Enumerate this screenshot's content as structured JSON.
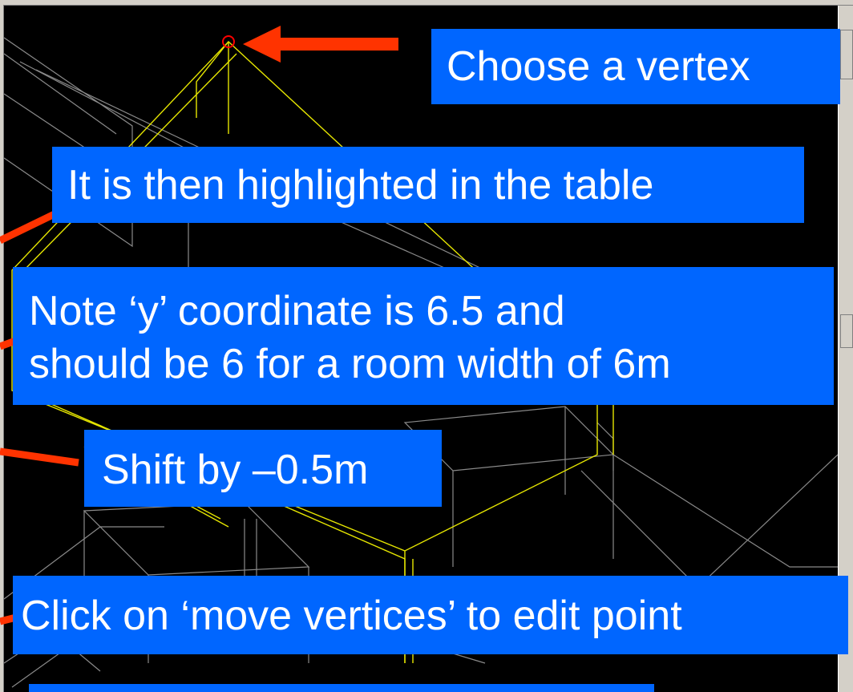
{
  "colors": {
    "callout_bg": "#0066ff",
    "callout_text": "#ffffff",
    "pointer_red": "#ff3300",
    "wire_yellow": "#e6e600",
    "wire_grey": "#8a8a8a",
    "vertex_marker": "#ff0000",
    "canvas_bg": "#000000",
    "frame": "#d4d0c8"
  },
  "callouts": {
    "choose_vertex": "Choose a vertex",
    "highlighted": "It is then highlighted in the table",
    "note_line1": "Note ‘y’ coordinate is 6.5 and",
    "note_line2": "should be 6 for a room width of 6m",
    "shift": "Shift by –0.5m",
    "click_move": "Click on ‘move vertices’ to edit point",
    "bottom_partial": ""
  },
  "icons": {
    "vertex_marker": "selected-vertex-circle-icon",
    "pointer": "red-arrow-pointer-icon"
  }
}
